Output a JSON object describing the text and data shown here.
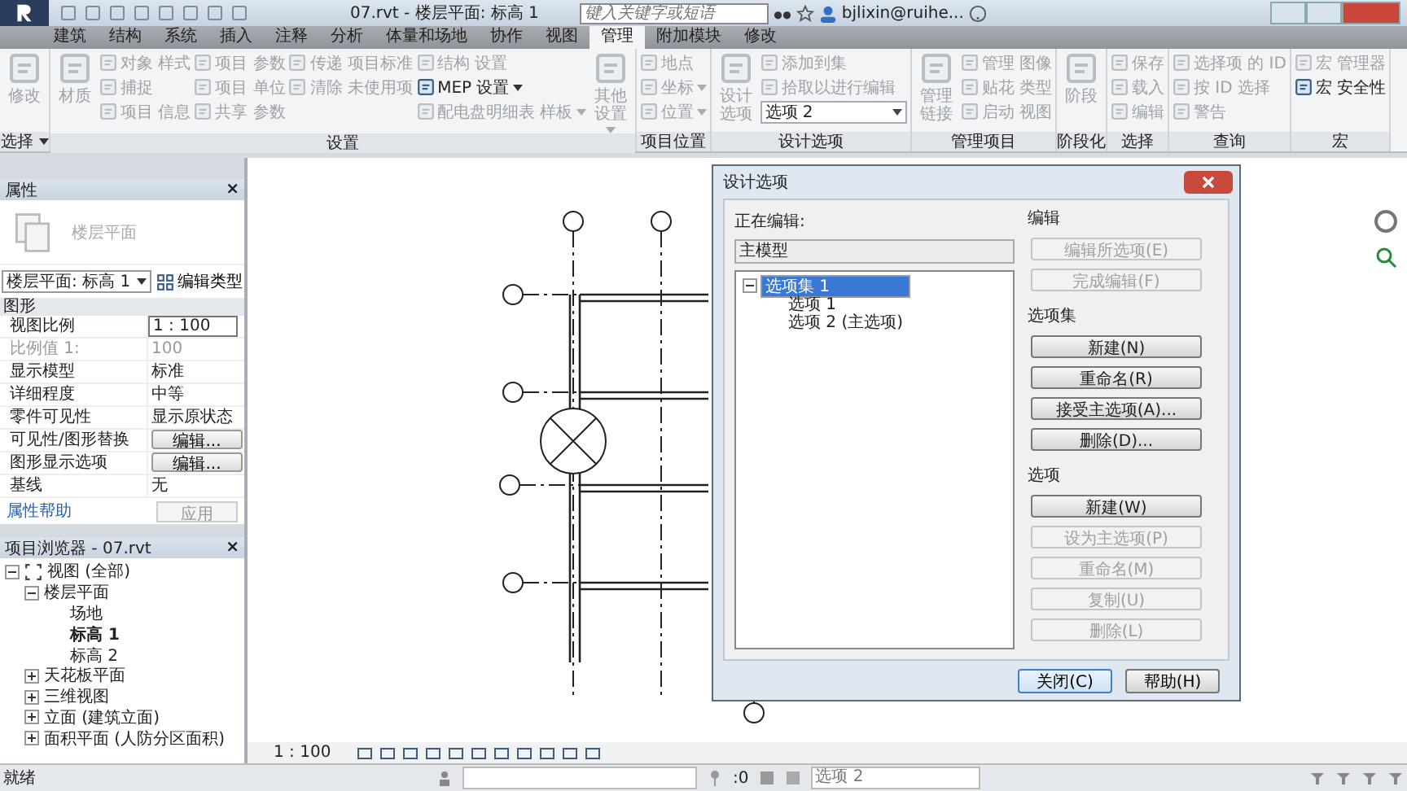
{
  "window": {
    "title": "07.rvt - 楼层平面: 标高 1"
  },
  "search": {
    "placeholder": "键入关键字或短语"
  },
  "user": "bjlixin@ruihe...",
  "tabs": [
    {
      "label": "建筑",
      "selected": false
    },
    {
      "label": "结构",
      "selected": false
    },
    {
      "label": "系统",
      "selected": false
    },
    {
      "label": "插入",
      "selected": false
    },
    {
      "label": "注释",
      "selected": false
    },
    {
      "label": "分析",
      "selected": false
    },
    {
      "label": "体量和场地",
      "selected": false
    },
    {
      "label": "协作",
      "selected": false
    },
    {
      "label": "视图",
      "selected": false
    },
    {
      "label": "管理",
      "selected": true
    },
    {
      "label": "附加模块",
      "selected": false
    },
    {
      "label": "修改",
      "selected": false
    }
  ],
  "ribbon": [
    {
      "label": "选择",
      "has_menu": true,
      "groups": [
        {
          "kind": "large",
          "items": [
            {
              "label": "修改",
              "disabled": true,
              "menu": false
            }
          ]
        }
      ]
    },
    {
      "label": "设置",
      "has_menu": false,
      "groups": [
        {
          "kind": "large",
          "items": [
            {
              "label": "材质",
              "disabled": true,
              "menu": false
            }
          ]
        },
        {
          "kind": "stack",
          "items": [
            {
              "label": "对象 样式",
              "disabled": true,
              "menu": false
            },
            {
              "label": "捕捉",
              "disabled": true,
              "menu": false
            },
            {
              "label": "项目 信息",
              "disabled": true,
              "menu": false
            }
          ]
        },
        {
          "kind": "stack",
          "items": [
            {
              "label": "项目 参数",
              "disabled": true,
              "menu": false
            },
            {
              "label": "项目 单位",
              "disabled": true,
              "menu": false
            },
            {
              "label": "共享 参数",
              "disabled": true,
              "menu": false
            }
          ]
        },
        {
          "kind": "stack",
          "items": [
            {
              "label": "传递 项目标准",
              "disabled": true,
              "menu": false
            },
            {
              "label": "清除 未使用项",
              "disabled": true,
              "menu": false
            }
          ]
        },
        {
          "kind": "stack",
          "items": [
            {
              "label": "结构 设置",
              "disabled": true,
              "menu": false
            },
            {
              "label": "MEP 设置",
              "disabled": false,
              "menu": true
            },
            {
              "label": "配电盘明细表 样板",
              "disabled": true,
              "menu": true
            }
          ]
        },
        {
          "kind": "large",
          "items": [
            {
              "label": "其他设置",
              "disabled": true,
              "menu": true
            }
          ]
        }
      ]
    },
    {
      "label": "项目位置",
      "has_menu": false,
      "groups": [
        {
          "kind": "stack",
          "items": [
            {
              "label": "地点",
              "disabled": true,
              "menu": false
            },
            {
              "label": "坐标",
              "disabled": true,
              "menu": true
            },
            {
              "label": "位置",
              "disabled": true,
              "menu": true
            }
          ]
        }
      ]
    },
    {
      "label": "设计选项",
      "has_menu": false,
      "groups": [
        {
          "kind": "large",
          "items": [
            {
              "label": "设计选项",
              "disabled": true,
              "menu": false
            }
          ]
        },
        {
          "kind": "stack",
          "items": [
            {
              "label": "添加到集",
              "disabled": true,
              "menu": false
            },
            {
              "label": "拾取以进行编辑",
              "disabled": true,
              "menu": false
            },
            {
              "kind": "dropdown",
              "label": "选项 2",
              "disabled": false,
              "menu": true
            }
          ]
        }
      ]
    },
    {
      "label": "管理项目",
      "has_menu": false,
      "groups": [
        {
          "kind": "large",
          "items": [
            {
              "label": "管理链接",
              "disabled": true,
              "menu": false
            }
          ]
        },
        {
          "kind": "stack",
          "items": [
            {
              "label": "管理 图像",
              "disabled": true,
              "menu": false
            },
            {
              "label": "贴花 类型",
              "disabled": true,
              "menu": false
            },
            {
              "label": "启动 视图",
              "disabled": true,
              "menu": false
            }
          ]
        }
      ]
    },
    {
      "label": "阶段化",
      "has_menu": false,
      "groups": [
        {
          "kind": "large",
          "items": [
            {
              "label": "阶段",
              "disabled": true,
              "menu": false
            }
          ]
        }
      ]
    },
    {
      "label": "选择",
      "has_menu": false,
      "groups": [
        {
          "kind": "stack",
          "items": [
            {
              "label": "保存",
              "disabled": true,
              "menu": false
            },
            {
              "label": "载入",
              "disabled": true,
              "menu": false
            },
            {
              "label": "编辑",
              "disabled": true,
              "menu": false
            }
          ]
        }
      ]
    },
    {
      "label": "查询",
      "has_menu": false,
      "groups": [
        {
          "kind": "stack",
          "items": [
            {
              "label": "选择项 的 ID",
              "disabled": true,
              "menu": false
            },
            {
              "label": "按 ID 选择",
              "disabled": true,
              "menu": false
            },
            {
              "label": "警告",
              "disabled": true,
              "menu": false
            }
          ]
        }
      ]
    },
    {
      "label": "宏",
      "has_menu": false,
      "groups": [
        {
          "kind": "stack",
          "items": [
            {
              "label": "宏 管理器",
              "disabled": true,
              "menu": false
            },
            {
              "label": "宏 安全性",
              "disabled": false,
              "menu": false
            }
          ]
        }
      ]
    }
  ],
  "properties": {
    "title": "属性",
    "close": "×",
    "type_name": "楼层平面",
    "selector": "楼层平面: 标高 1",
    "edit_type": "编辑类型",
    "section": "图形",
    "rows": [
      {
        "label": "视图比例",
        "value": "1 : 100",
        "kind": "field",
        "disabled": false
      },
      {
        "label": "比例值 1:",
        "value": "100",
        "kind": "text",
        "disabled": true
      },
      {
        "label": "显示模型",
        "value": "标准",
        "kind": "text",
        "disabled": false
      },
      {
        "label": "详细程度",
        "value": "中等",
        "kind": "text",
        "disabled": false
      },
      {
        "label": "零件可见性",
        "value": "显示原状态",
        "kind": "text",
        "disabled": false
      },
      {
        "label": "可见性/图形替换",
        "value": "编辑...",
        "kind": "button",
        "disabled": false
      },
      {
        "label": "图形显示选项",
        "value": "编辑...",
        "kind": "button",
        "disabled": false
      },
      {
        "label": "基线",
        "value": "无",
        "kind": "text",
        "disabled": false
      }
    ],
    "help": "属性帮助",
    "apply": "应用"
  },
  "project_browser": {
    "title": "项目浏览器 - 07.rvt",
    "close": "×",
    "tree": [
      {
        "label": "视图 (全部)",
        "expanded": true,
        "current": false,
        "children": [
          {
            "label": "楼层平面",
            "expanded": true,
            "current": false,
            "children": [
              {
                "label": "场地",
                "current": false
              },
              {
                "label": "标高 1",
                "current": true
              },
              {
                "label": "标高 2",
                "current": false
              }
            ]
          },
          {
            "label": "天花板平面",
            "expanded": false,
            "current": false
          },
          {
            "label": "三维视图",
            "expanded": false,
            "current": false
          },
          {
            "label": "立面 (建筑立面)",
            "expanded": false,
            "current": false
          },
          {
            "label": "面积平面 (人防分区面积)",
            "expanded": false,
            "current": false
          }
        ]
      }
    ]
  },
  "view_bar": {
    "scale": "1 : 100"
  },
  "status_bar": {
    "text": "就绪",
    "count": ":0",
    "option": "选项 2"
  },
  "dialog": {
    "title": "设计选项",
    "editing_label": "正在编辑:",
    "editing_value": "主模型",
    "tree": [
      {
        "label": "选项集 1",
        "selected": true,
        "children": [
          {
            "label": "选项 1",
            "selected": false
          },
          {
            "label": "选项 2 (主选项)",
            "selected": false
          }
        ]
      }
    ],
    "groups": [
      {
        "label": "编辑",
        "buttons": [
          {
            "label": "编辑所选项(E)",
            "disabled": true
          },
          {
            "label": "完成编辑(F)",
            "disabled": true
          }
        ]
      },
      {
        "label": "选项集",
        "buttons": [
          {
            "label": "新建(N)",
            "disabled": false
          },
          {
            "label": "重命名(R)",
            "disabled": false
          },
          {
            "label": "接受主选项(A)...",
            "disabled": false
          },
          {
            "label": "删除(D)...",
            "disabled": false
          }
        ]
      },
      {
        "label": "选项",
        "buttons": [
          {
            "label": "新建(W)",
            "disabled": false
          },
          {
            "label": "设为主选项(P)",
            "disabled": true
          },
          {
            "label": "重命名(M)",
            "disabled": true
          },
          {
            "label": "复制(U)",
            "disabled": true
          },
          {
            "label": "删除(L)",
            "disabled": true
          }
        ]
      }
    ],
    "footer": [
      {
        "label": "关闭(C)",
        "default": true
      },
      {
        "label": "帮助(H)",
        "default": false
      }
    ]
  }
}
